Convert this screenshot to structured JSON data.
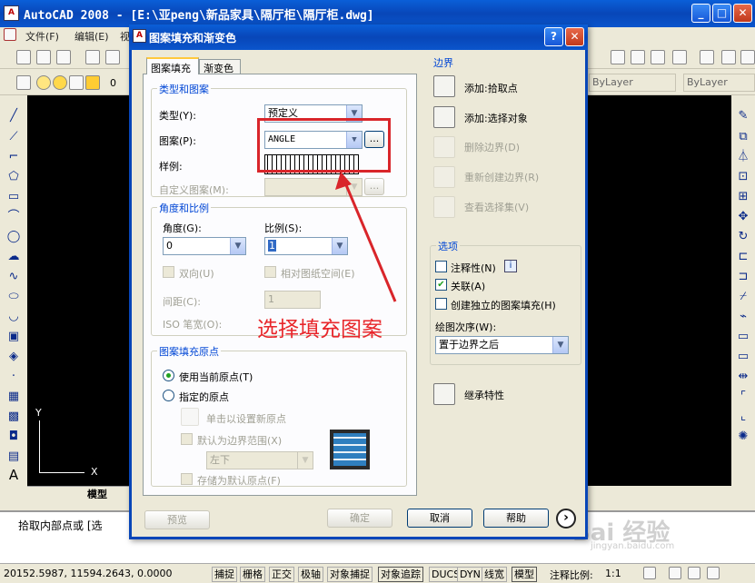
{
  "app": {
    "title": "AutoCAD 2008 - [E:\\亚peng\\新品家具\\隔厅柜\\隔厅柜.dwg]",
    "logo": "A",
    "menus": [
      "文件(F)",
      "编辑(E)",
      "视"
    ],
    "layer": "0",
    "bylayer1": "ByLayer",
    "bylayer2": "ByLayer",
    "win_min": "_",
    "win_max": "□",
    "win_close": "✕"
  },
  "drawing": {
    "axis_y": "Y",
    "axis_x": "X",
    "tab_model": "模型"
  },
  "command": {
    "line1": "拾取内部点或 [选"
  },
  "status": {
    "coords": "20152.5987, 11594.2643, 0.0000",
    "buttons": [
      "捕捉",
      "栅格",
      "正交",
      "极轴",
      "对象捕捉",
      "对象追踪",
      "DUCS",
      "DYN",
      "线宽",
      "模型"
    ],
    "scale_label": "注释比例:",
    "scale_value": "1:1"
  },
  "dialog": {
    "title": "图案填充和渐变色",
    "help_btn": "?",
    "close_btn": "✕",
    "tabs": [
      "图案填充",
      "渐变色"
    ],
    "type_pattern": {
      "label": "类型和图案",
      "type_label": "类型(Y):",
      "type_value": "预定义",
      "pattern_label": "图案(P):",
      "pattern_value": "ANGLE",
      "sample_label": "样例:",
      "custom_label": "自定义图案(M):",
      "browse": "..."
    },
    "angle_scale": {
      "label": "角度和比例",
      "angle_label": "角度(G):",
      "angle_value": "0",
      "scale_label": "比例(S):",
      "scale_value": "1",
      "double_label": "双向(U)",
      "relative_label": "相对图纸空间(E)",
      "spacing_label": "间距(C):",
      "spacing_value": "1",
      "iso_label": "ISO 笔宽(O):"
    },
    "origin": {
      "label": "图案填充原点",
      "use_current": "使用当前原点(T)",
      "specified": "指定的原点",
      "click_set": "单击以设置新原点",
      "default_extent": "默认为边界范围(X)",
      "extent_value": "左下",
      "store_default": "存储为默认原点(F)"
    },
    "boundary": {
      "label": "边界",
      "add_pick": "添加:拾取点",
      "add_select": "添加:选择对象",
      "remove": "删除边界(D)",
      "recreate": "重新创建边界(R)",
      "view_select": "查看选择集(V)"
    },
    "options": {
      "label": "选项",
      "annotative": "注释性(N)",
      "info": "i",
      "associative": "关联(A)",
      "independent": "创建独立的图案填充(H)",
      "draw_order_label": "绘图次序(W):",
      "draw_order_value": "置于边界之后"
    },
    "inherit": "继承特性",
    "buttons": {
      "preview": "预览",
      "ok": "确定",
      "cancel": "取消",
      "help": "帮助",
      "more": "›"
    }
  },
  "annotation": {
    "text": "选择填充图案",
    "color": "#e8262a"
  },
  "watermark": {
    "text": "Bai 经验",
    "sub": "jingyan.baidu.com"
  }
}
